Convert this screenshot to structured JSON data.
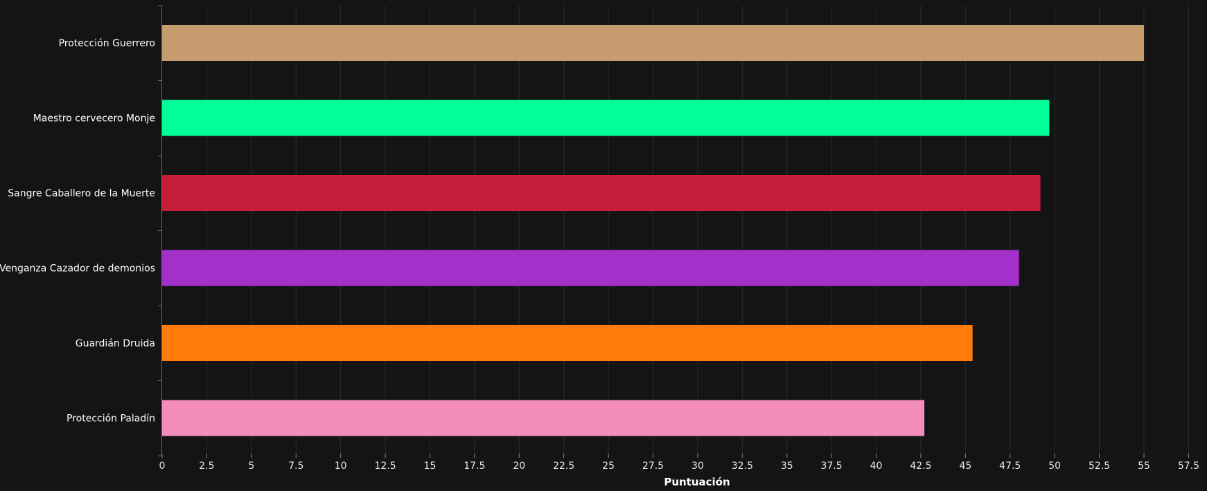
{
  "chart_data": {
    "type": "bar",
    "orientation": "horizontal",
    "title": "",
    "xlabel": "Puntuación",
    "ylabel": "",
    "xlim": [
      0,
      57.5
    ],
    "x_tick_step": 2.5,
    "x_ticks": [
      "0",
      "2.5",
      "5",
      "7.5",
      "10",
      "12.5",
      "15",
      "17.5",
      "20",
      "22.5",
      "25",
      "27.5",
      "30",
      "32.5",
      "35",
      "37.5",
      "40",
      "42.5",
      "45",
      "47.5",
      "50",
      "52.5",
      "55",
      "57.5"
    ],
    "grid": "vertical",
    "legend": "none",
    "background": "#141414",
    "categories": [
      "Protección Guerrero",
      "Maestro cervecero Monje",
      "Sangre Caballero de la Muerte",
      "Venganza Cazador de demonios",
      "Guardián Druida",
      "Protección Paladín"
    ],
    "values": [
      55.0,
      49.7,
      49.2,
      48.0,
      45.4,
      42.7
    ],
    "colors": [
      "#C69B6D",
      "#00FF98",
      "#C41E3A",
      "#A330C9",
      "#FF7C0A",
      "#F48CBA"
    ]
  }
}
